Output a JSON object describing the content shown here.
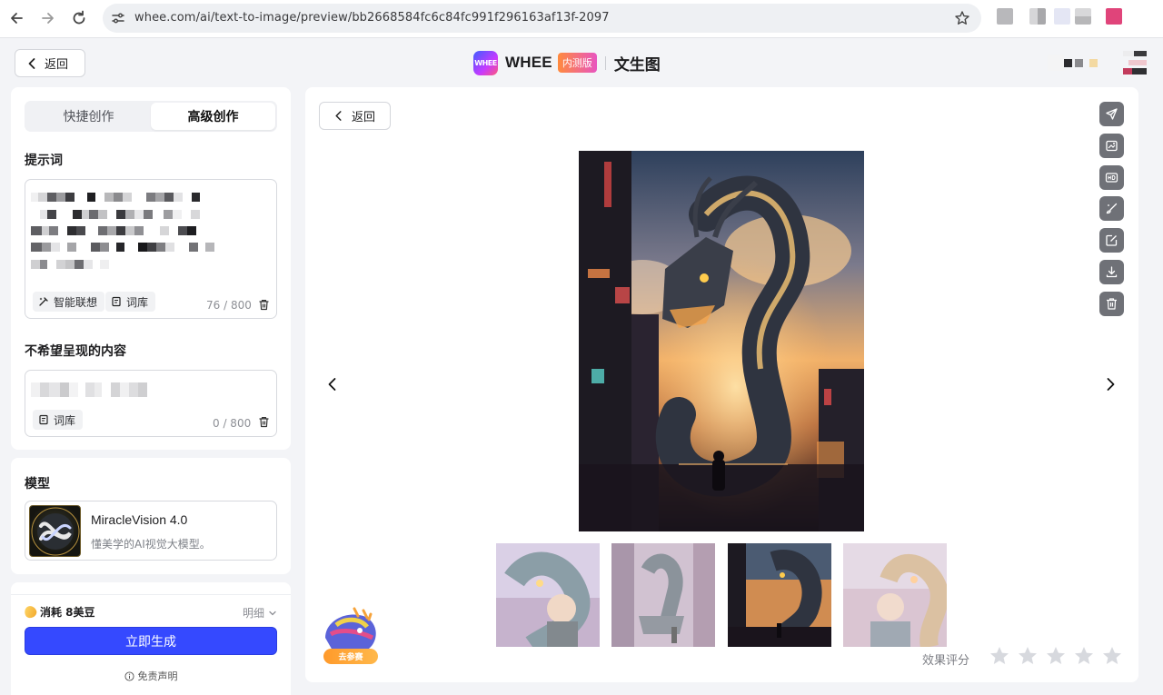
{
  "browser": {
    "url": "whee.com/ai/text-to-image/preview/bb2668584fc6c84fc991f296163af13f-2097"
  },
  "header": {
    "back_label": "返回",
    "logo_mark": "WHEE",
    "logo_text": "WHEE",
    "beta_badge": "内测版",
    "title": "文生图"
  },
  "left": {
    "tabs": [
      {
        "label": "快捷创作",
        "active": false
      },
      {
        "label": "高级创作",
        "active": true
      }
    ],
    "prompt": {
      "label": "提示词",
      "smart_label": "智能联想",
      "lexicon_label": "词库",
      "counter": "76 / 800"
    },
    "negative": {
      "label": "不希望呈现的内容",
      "lexicon_label": "词库",
      "counter": "0 / 800"
    },
    "model": {
      "section_label": "模型",
      "name": "MiracleVision 4.0",
      "desc": "懂美学的AI视觉大模型。"
    },
    "footer": {
      "cost": "消耗 8美豆",
      "detail": "明细",
      "generate": "立即生成",
      "disclaimer": "免责声明"
    }
  },
  "main": {
    "back_label": "返回",
    "rating_label": "效果评分",
    "rating_value": 0,
    "rating_max": 5,
    "mascot_label": "去参赛",
    "thumbnails": 4,
    "selected_thumbnail": 3
  },
  "colors": {
    "accent": "#3549ff",
    "tool_button": "#6f7177",
    "star_empty": "#d7d9de"
  }
}
